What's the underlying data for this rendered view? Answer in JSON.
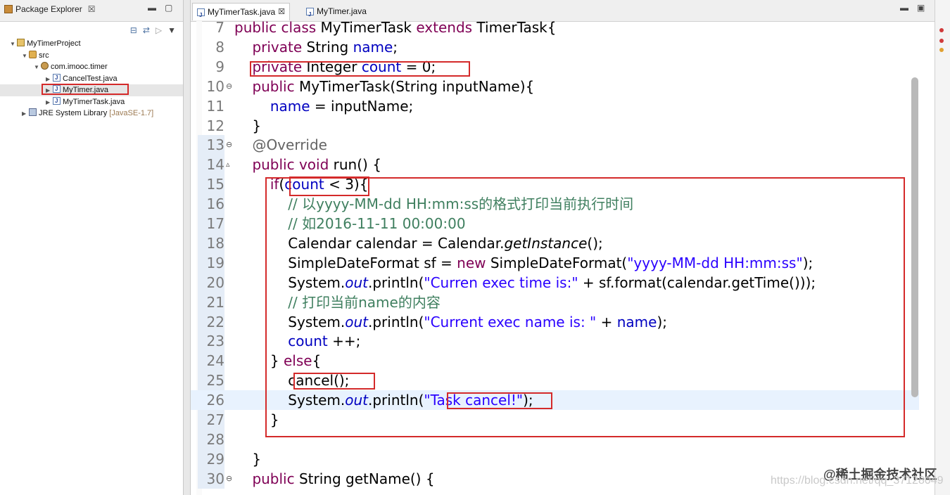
{
  "explorer": {
    "title": "Package Explorer",
    "tree": [
      {
        "label": "MyTimerProject",
        "icon": "project",
        "level": 0,
        "arrow": "▼"
      },
      {
        "label": "src",
        "icon": "src",
        "level": 1,
        "arrow": "▼"
      },
      {
        "label": "com.imooc.timer",
        "icon": "pkg",
        "level": 2,
        "arrow": "▼"
      },
      {
        "label": "CancelTest.java",
        "icon": "java",
        "level": 3,
        "arrow": "▶"
      },
      {
        "label": "MyTimer.java",
        "icon": "java",
        "level": 3,
        "arrow": "▶",
        "selected": true
      },
      {
        "label": "MyTimerTask.java",
        "icon": "java",
        "level": 3,
        "arrow": "▶"
      },
      {
        "label": "JRE System Library",
        "suffix": "[JavaSE-1.7]",
        "icon": "lib",
        "level": 1,
        "arrow": "▶"
      }
    ]
  },
  "editor": {
    "tabs": [
      {
        "label": "MyTimerTask.java",
        "active": true
      },
      {
        "label": "MyTimer.java",
        "active": false
      }
    ],
    "lines": [
      {
        "num": "7",
        "html": "<span class='kw'>public class</span> MyTimerTask <span class='kw'>extends</span> TimerTask{"
      },
      {
        "num": "8",
        "html": "    <span class='kw'>private</span> String <span class='fld'>name</span>;"
      },
      {
        "num": "9",
        "html": "    <span class='kw'>private</span> Integer <span class='fld'>count</span> = 0;"
      },
      {
        "num": "10",
        "mark": "⊖",
        "html": "    <span class='kw'>public</span> MyTimerTask(String inputName){"
      },
      {
        "num": "11",
        "html": "        <span class='fld'>name</span> = inputName;"
      },
      {
        "num": "12",
        "html": "    }"
      },
      {
        "num": "13",
        "mark": "⊖",
        "html": "    <span class='ann'>@Override</span>"
      },
      {
        "num": "14",
        "mark": "▵",
        "html": "    <span class='kw'>public void</span> run() {"
      },
      {
        "num": "15",
        "html": "        <span class='kw'>if</span>(<span class='fld'>count</span> &lt; 3){"
      },
      {
        "num": "16",
        "html": "            <span class='cmt'>// 以yyyy-MM-dd HH:mm:ss的格式打印当前执行时间</span>"
      },
      {
        "num": "17",
        "html": "            <span class='cmt'>// 如2016-11-11 00:00:00</span>"
      },
      {
        "num": "18",
        "html": "            Calendar calendar = Calendar.<span class='it'>getInstance</span>();"
      },
      {
        "num": "19",
        "html": "            SimpleDateFormat sf = <span class='kw'>new</span> SimpleDateFormat(<span class='str'>\"yyyy-MM-dd HH:mm:ss\"</span>);"
      },
      {
        "num": "20",
        "html": "            System.<span class='fld it'>out</span>.println(<span class='str'>\"Curren exec time is:\"</span> + sf.format(calendar.getTime()));"
      },
      {
        "num": "21",
        "html": "            <span class='cmt'>// 打印当前name的内容</span>"
      },
      {
        "num": "22",
        "html": "            System.<span class='fld it'>out</span>.println(<span class='str'>\"Current exec name is: \"</span> + <span class='fld'>name</span>);"
      },
      {
        "num": "23",
        "html": "            <span class='fld'>count</span> ++;"
      },
      {
        "num": "24",
        "html": "        } <span class='kw'>else</span>{"
      },
      {
        "num": "25",
        "html": "            cancel();"
      },
      {
        "num": "26",
        "html": "            System.<span class='fld it'>out</span>.println(<span class='str'>\"Task cancel!\"</span>);"
      },
      {
        "num": "27",
        "html": "        }"
      },
      {
        "num": "28",
        "html": ""
      },
      {
        "num": "29",
        "html": "    }"
      },
      {
        "num": "30",
        "mark": "⊖",
        "html": "    <span class='kw'>public</span> String getName() {"
      }
    ]
  },
  "watermark": "https://blog.csdn.net/qq_37128049",
  "watermark_brand": "@稀土掘金技术社区"
}
